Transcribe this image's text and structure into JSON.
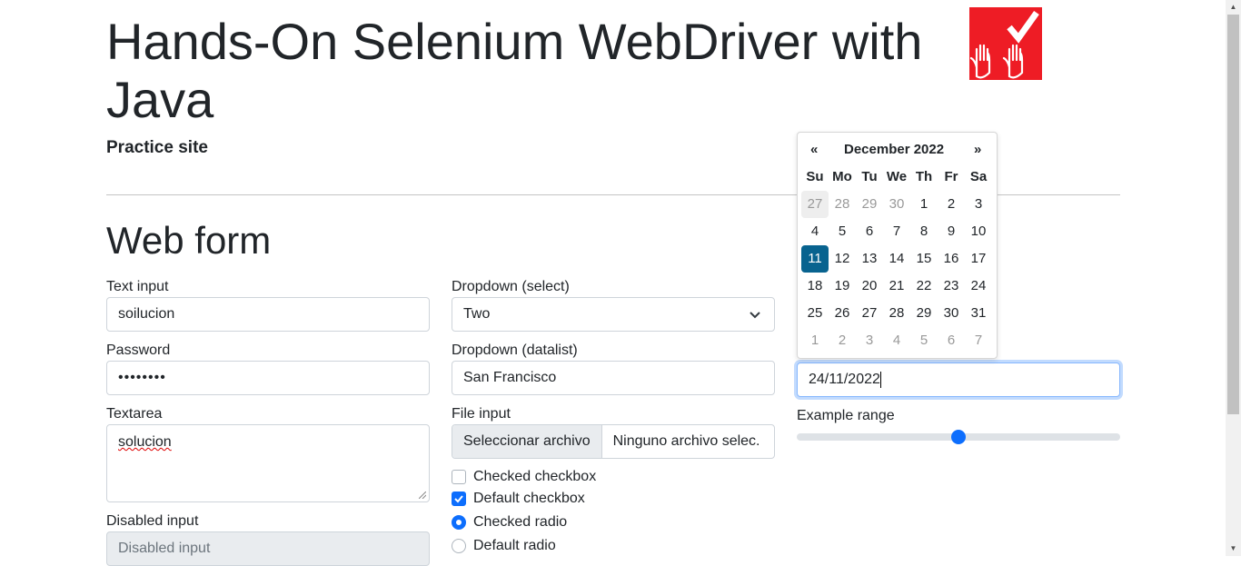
{
  "header": {
    "title": "Hands-On Selenium WebDriver with Java",
    "subtitle": "Practice site",
    "logo_icon": "hands-check-logo"
  },
  "form": {
    "title": "Web form",
    "text_input": {
      "label": "Text input",
      "value": "soilucion"
    },
    "password": {
      "label": "Password",
      "value": "••••••••"
    },
    "textarea": {
      "label": "Textarea",
      "value": "solucion"
    },
    "disabled_input": {
      "label": "Disabled input",
      "placeholder": "Disabled input"
    },
    "dropdown_select": {
      "label": "Dropdown (select)",
      "selected": "Two"
    },
    "dropdown_datalist": {
      "label": "Dropdown (datalist)",
      "value": "San Francisco"
    },
    "file_input": {
      "label": "File input",
      "button": "Seleccionar archivo",
      "status": "Ninguno archivo selec."
    },
    "checkboxes": [
      {
        "label": "Checked checkbox",
        "checked": false
      },
      {
        "label": "Default checkbox",
        "checked": true
      }
    ],
    "radios": [
      {
        "label": "Checked radio",
        "checked": true
      },
      {
        "label": "Default radio",
        "checked": false
      }
    ],
    "date_input": {
      "value": "24/11/2022"
    },
    "range": {
      "label": "Example range",
      "value_fraction": 0.5
    }
  },
  "datepicker": {
    "prev": "«",
    "next": "»",
    "month_label": "December 2022",
    "weekdays": [
      "Su",
      "Mo",
      "Tu",
      "We",
      "Th",
      "Fr",
      "Sa"
    ],
    "weeks": [
      [
        "27",
        "28",
        "29",
        "30",
        "1",
        "2",
        "3"
      ],
      [
        "4",
        "5",
        "6",
        "7",
        "8",
        "9",
        "10"
      ],
      [
        "11",
        "12",
        "13",
        "14",
        "15",
        "16",
        "17"
      ],
      [
        "18",
        "19",
        "20",
        "21",
        "22",
        "23",
        "24"
      ],
      [
        "25",
        "26",
        "27",
        "28",
        "29",
        "30",
        "31"
      ],
      [
        "1",
        "2",
        "3",
        "4",
        "5",
        "6",
        "7"
      ]
    ],
    "selected_day": "11",
    "accent_color": "#08638f"
  },
  "colors": {
    "primary": "#0d6efd",
    "logo_red": "#ee1c25"
  }
}
